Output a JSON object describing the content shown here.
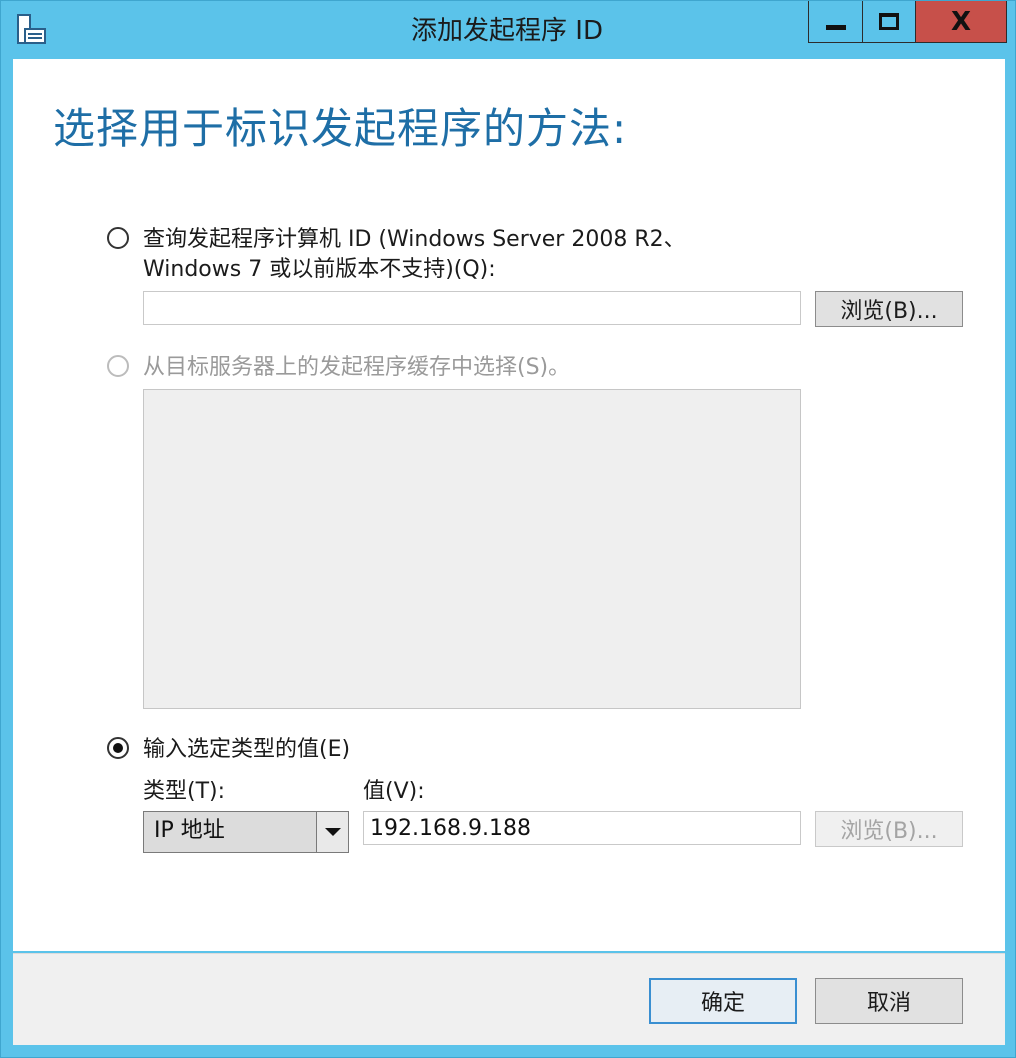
{
  "window": {
    "title": "添加发起程序 ID",
    "controls": {
      "minimize": "minimize",
      "maximize": "maximize",
      "close": "X"
    }
  },
  "heading": "选择用于标识发起程序的方法:",
  "options": {
    "query": {
      "label_line1": "查询发起程序计算机 ID (Windows Server 2008 R2、",
      "label_line2": "Windows 7 或以前版本不支持)(Q):",
      "value": "",
      "browse_label": "浏览(B)...",
      "selected": false
    },
    "cache": {
      "label": "从目标服务器上的发起程序缓存中选择(S)。",
      "enabled": false,
      "selected": false
    },
    "manual": {
      "label": "输入选定类型的值(E)",
      "selected": true,
      "type_label": "类型(T):",
      "type_value": "IP 地址",
      "value_label": "值(V):",
      "value": "192.168.9.188",
      "browse_label": "浏览(B)..."
    }
  },
  "footer": {
    "ok_label": "确定",
    "cancel_label": "取消"
  },
  "icons": {
    "app": "iscsi-initiator-icon",
    "dropdown": "chevron-down-icon"
  },
  "colors": {
    "frame": "#5bc3ea",
    "heading": "#1e6ea6",
    "close": "#c7504a"
  }
}
